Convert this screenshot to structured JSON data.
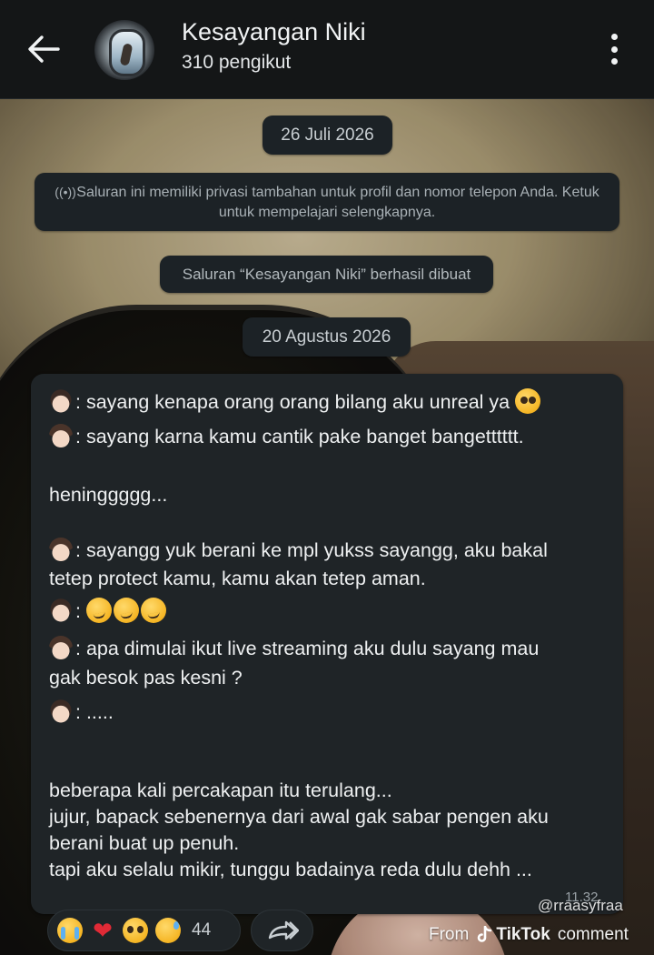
{
  "header": {
    "title": "Kesayangan Niki",
    "subtitle": "310 pengikut",
    "back_icon": "arrow-left-icon",
    "menu_icon": "more-vertical-icon"
  },
  "system": {
    "date1": "26 Juli 2026",
    "privacy_notice": "Saluran ini memiliki privasi tambahan untuk profil dan nomor telepon Anda. Ketuk untuk mempelajari selengkapnya.",
    "created_notice": "Saluran “Kesayangan Niki” berhasil dibuat",
    "date2": "20 Agustus 2026"
  },
  "message": {
    "lines": [
      ": sayang kenapa orang orang bilang aku unreal ya",
      ": sayang karna kamu cantik pake banget bangetttttt.",
      "heninggggg...",
      ": sayangg yuk berani ke mpl yukss sayangg, aku bakal",
      "tetep protect kamu, kamu akan tetep aman.",
      ":",
      ": apa dimulai ikut live streaming aku dulu sayang mau",
      "gak besok pas kesni ?",
      ": .....",
      "beberapa kali percakapan itu terulang...",
      "jujur, bapack sebenernya dari awal gak sabar pengen aku",
      "berani buat up penuh.",
      "tapi aku selalu mikir, tunggu badainya reda dulu dehh ..."
    ],
    "time": "11.32"
  },
  "reactions": {
    "icons": [
      "crying-face-icon",
      "heart-icon",
      "pleading-face-icon",
      "sad-face-icon"
    ],
    "count": "44"
  },
  "watermark": {
    "user": "@rraasyfraa",
    "from": "From",
    "brand": "TikTok",
    "suffix": "comment"
  },
  "colors": {
    "header_bg": "#141617",
    "bubble_bg": "#1f2427",
    "pill_bg": "#1c2226",
    "text_primary": "#eef0f1",
    "heart": "#e02a36"
  }
}
